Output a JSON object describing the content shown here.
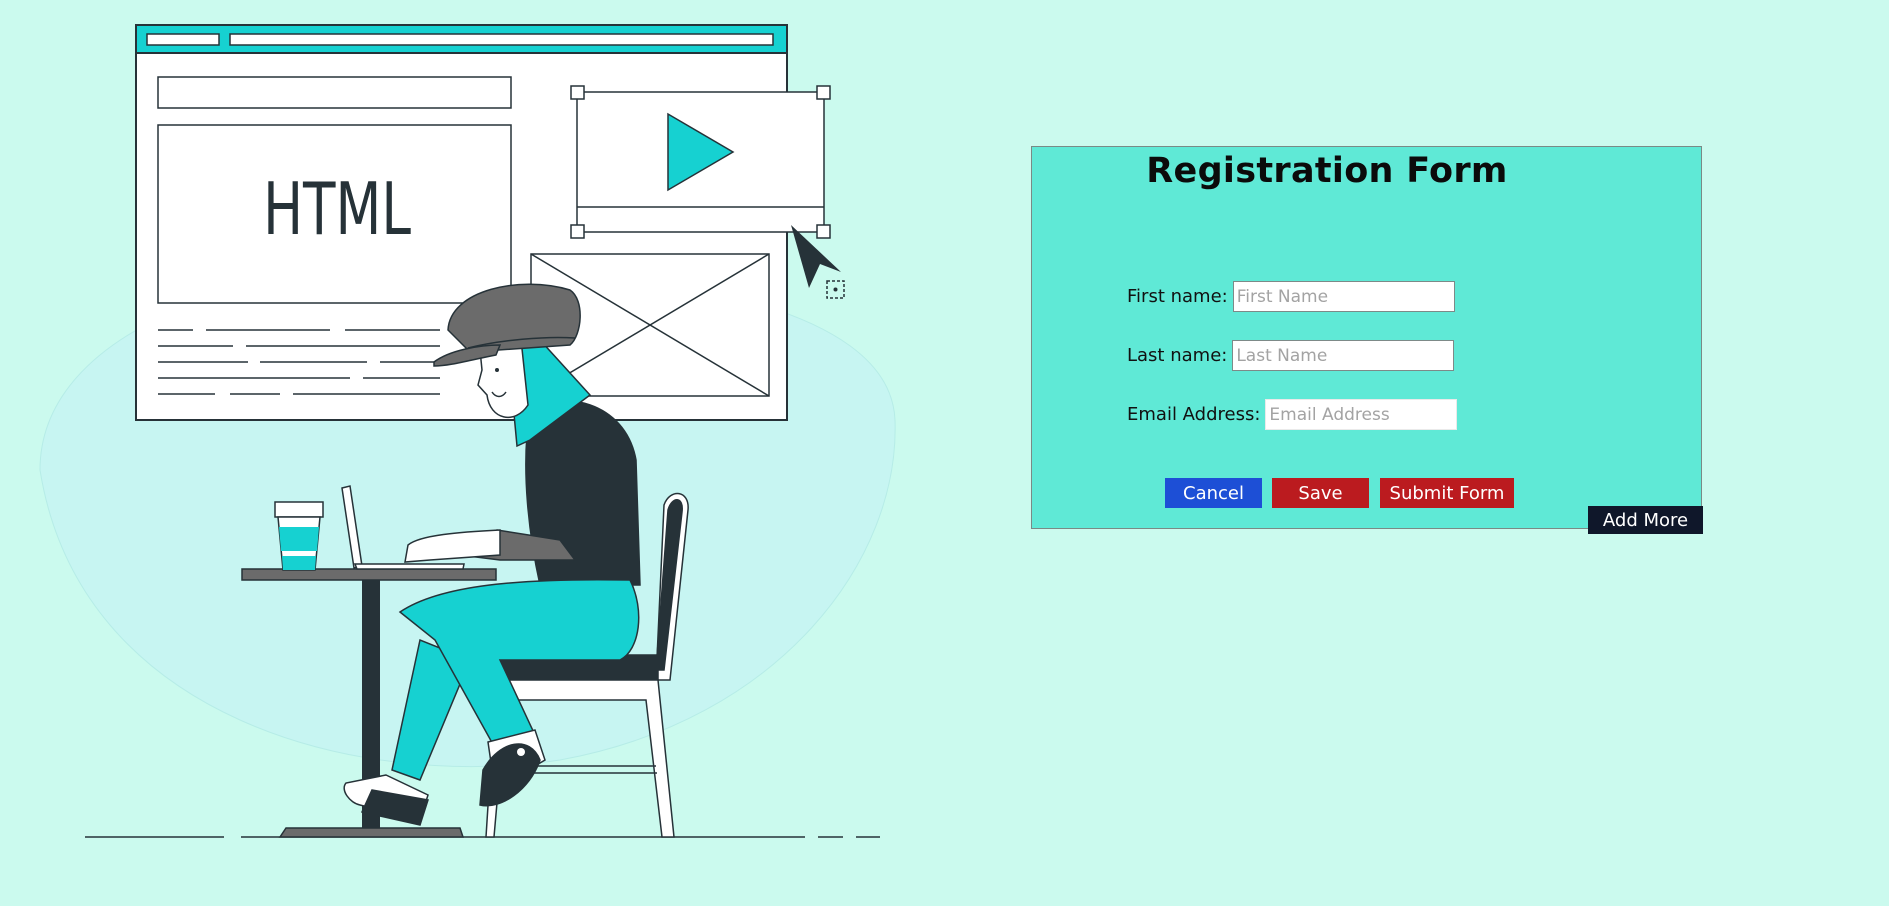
{
  "illustration": {
    "browser_text": "HTML"
  },
  "form": {
    "title": "Registration Form",
    "first_name": {
      "label": "First name:",
      "placeholder": "First Name",
      "value": ""
    },
    "last_name": {
      "label": "Last name:",
      "placeholder": "Last Name",
      "value": ""
    },
    "email": {
      "label": "Email Address:",
      "placeholder": "Email Address",
      "value": ""
    },
    "buttons": {
      "cancel": "Cancel",
      "save": "Save",
      "submit": "Submit Form",
      "add_more": "Add More"
    }
  },
  "colors": {
    "page_background": "#cbfaee",
    "form_background": "#5fe9d6",
    "accent_teal": "#16d1d1",
    "cancel_button": "#1d4fd6",
    "save_button": "#bb1b1f",
    "submit_button": "#bb1b1f",
    "add_more_button": "#0f172a"
  }
}
